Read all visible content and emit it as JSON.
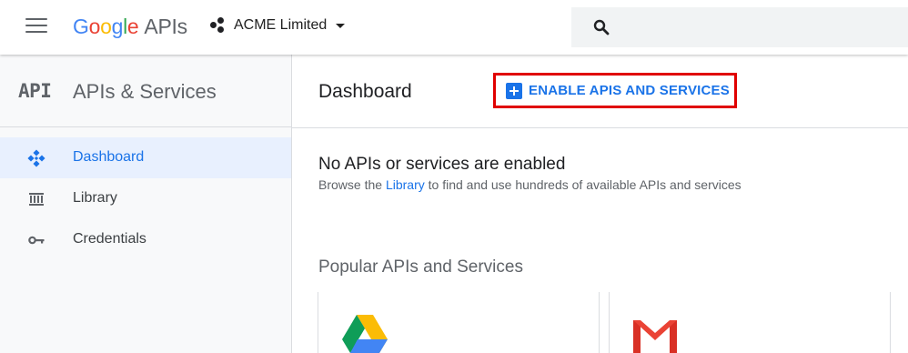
{
  "header": {
    "logo_google": [
      "G",
      "o",
      "o",
      "g",
      "l",
      "e"
    ],
    "logo_product": "APIs",
    "project_name": "ACME Limited"
  },
  "sidebar": {
    "badge": "API",
    "title": "APIs & Services",
    "items": [
      {
        "label": "Dashboard",
        "icon": "dashboard-icon",
        "active": true
      },
      {
        "label": "Library",
        "icon": "library-icon",
        "active": false
      },
      {
        "label": "Credentials",
        "icon": "key-icon",
        "active": false
      }
    ]
  },
  "main": {
    "title": "Dashboard",
    "enable_button": "ENABLE APIS AND SERVICES",
    "empty_title": "No APIs or services are enabled",
    "empty_desc_before": "Browse the ",
    "empty_desc_link": "Library",
    "empty_desc_after": " to find and use hundreds of available APIs and services",
    "popular_title": "Popular APIs and Services",
    "cards": [
      {
        "icon": "google-drive-icon"
      },
      {
        "icon": "gmail-icon"
      }
    ]
  },
  "colors": {
    "accent": "#1a73e8",
    "highlight_border": "#e00000",
    "sidebar_bg": "#f8f9fa",
    "active_bg": "#e8f0fe"
  }
}
